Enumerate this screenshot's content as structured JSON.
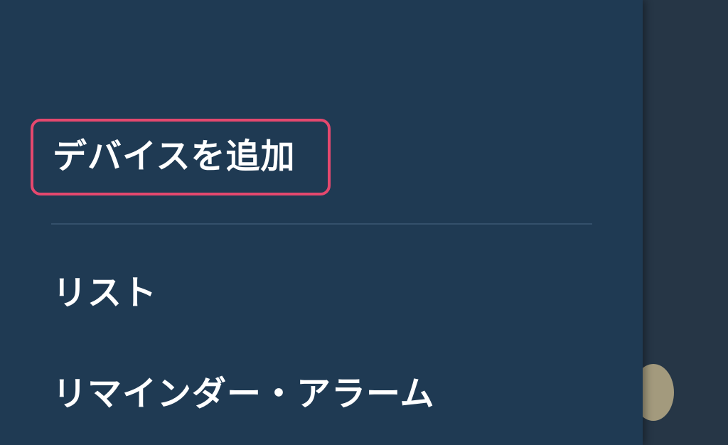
{
  "drawer": {
    "items": [
      {
        "id": "add-device",
        "label": "デバイスを追加",
        "highlighted": true
      },
      {
        "id": "list",
        "label": "リスト"
      },
      {
        "id": "reminders-alarms",
        "label": "リマインダー・アラーム"
      }
    ]
  },
  "colors": {
    "drawer_background": "#1f3a53",
    "overlay_background": "#263646",
    "highlight_ring": "#e5486e",
    "divider": "#34506b",
    "text": "#ffffff",
    "fab_peek": "#a39a7d"
  }
}
